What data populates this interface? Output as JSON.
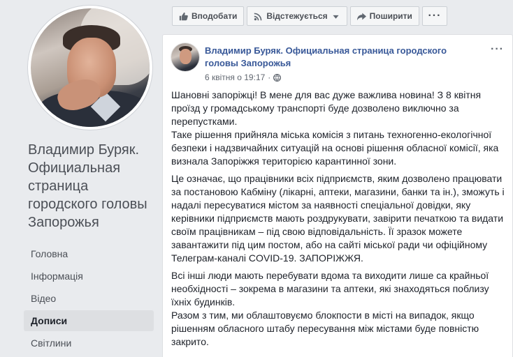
{
  "page": {
    "name": "Владимир Буряк. Официальная страница городского головы Запорожья"
  },
  "nav": {
    "items": [
      {
        "label": "Головна"
      },
      {
        "label": "Інформація"
      },
      {
        "label": "Відео"
      },
      {
        "label": "Дописи"
      },
      {
        "label": "Світлини"
      }
    ],
    "active_index": 3
  },
  "actions": {
    "like_label": "Вподобати",
    "follow_label": "Відстежується",
    "share_label": "Поширити",
    "more_label": "···"
  },
  "post": {
    "author": "Владимир Буряк. Официальная страница городского головы Запорожья",
    "timestamp": "6 квітня о 19:17",
    "separator": "·",
    "menu_label": "···",
    "paragraphs": [
      "Шановні запоріжці! В мене для вас дуже важлива новина! З 8 квітня проїзд у громадському транспорті буде дозволено виключно за перепустками.\nТаке рішення прийняла міська комісія з питань техногенно-екологічної безпеки і надзвичайних ситуацій на основі рішення обласної комісії, яка визнала Запоріжжя територією карантинної зони.",
      "Це означає, що працівники всіх підприємств, яким дозволено працювати за постановою Кабміну (лікарні, аптеки, магазини, банки та ін.), зможуть і надалі пересуватися містом за наявності спеціальної довідки, яку керівники підприємств мають роздрукувати, завірити печаткою та видати своїм працівникам – під свою відповідальність. Її зразок можете завантажити під цим постом, або на сайті міської ради чи офіційному Телеграм-каналі COVID-19. ЗАПОРІЖЖЯ.",
      "Всі інші люди мають перебувати вдома та виходити лише са крайньої необхідності – зокрема в магазини та аптеки, які знаходяться поблизу їхніх будинків.\nРазом з тим, ми облаштовуємо блокпости в місті на випадок, якщо рішенням обласного штабу пересування між містами буде повністю закрито."
    ]
  }
}
